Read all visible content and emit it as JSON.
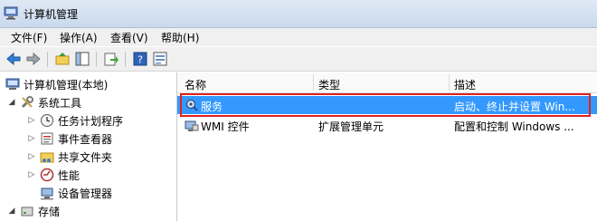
{
  "window": {
    "title": "计算机管理"
  },
  "menu": [
    "文件(F)",
    "操作(A)",
    "查看(V)",
    "帮助(H)"
  ],
  "toolbar": [
    "back-icon",
    "forward-icon",
    "up-folder-icon",
    "console-tree-icon",
    "export-icon",
    "help-icon",
    "properties-icon"
  ],
  "tree": {
    "root": "计算机管理(本地)",
    "system_tools": "系统工具",
    "items": [
      "任务计划程序",
      "事件查看器",
      "共享文件夹",
      "性能",
      "设备管理器"
    ],
    "storage": "存储"
  },
  "columns": [
    "名称",
    "类型",
    "描述"
  ],
  "rows": [
    {
      "name": "服务",
      "type": "",
      "desc": "启动、终止并设置 Win..."
    },
    {
      "name": "WMI 控件",
      "type": "扩展管理单元",
      "desc": "配置和控制 Windows ..."
    }
  ],
  "colors": {
    "selection": "#3399ff",
    "highlight_border": "#e02020"
  }
}
